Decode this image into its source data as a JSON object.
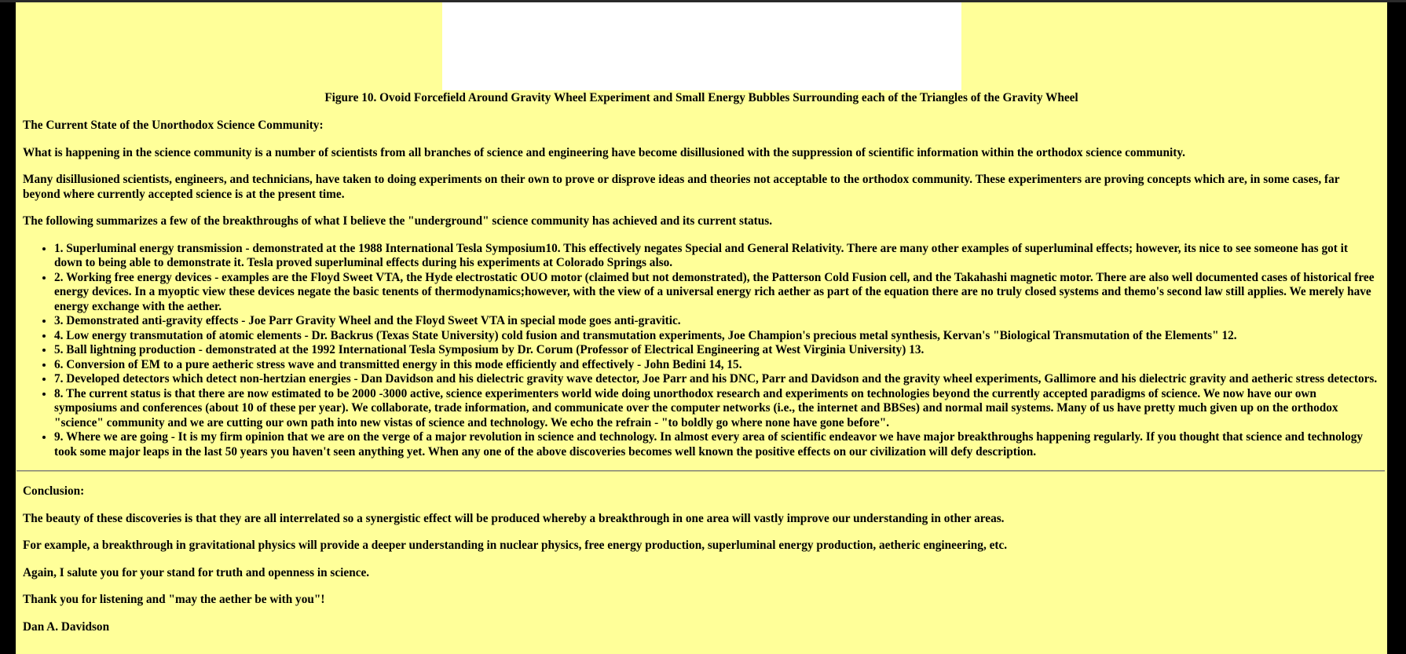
{
  "figure": {
    "caption": "Figure 10. Ovoid Forcefield Around Gravity Wheel Experiment and Small Energy Bubbles Surrounding each of the Triangles of the Gravity Wheel"
  },
  "section": {
    "heading": "The Current State of the Unorthodox Science Community:",
    "paragraphs": [
      "What is happening in the science community is a number of scientists from all branches of science and engineering have become disillusioned with the suppression of scientific information within the orthodox science community.",
      "Many disillusioned scientists, engineers, and technicians, have taken to doing experiments on their own to prove or disprove ideas and theories not acceptable to the orthodox community. These experimenters are proving concepts which are, in some cases, far beyond where currently accepted science is at the present time.",
      "The following summarizes a few of the breakthroughs of what I believe the \"underground\" science community has achieved and its current status."
    ],
    "list": [
      "1. Superluminal energy transmission - demonstrated at the 1988 International Tesla Symposium10. This effectively negates Special and General Relativity. There are many other examples of superluminal effects; however, its nice to see someone has got it down to being able to demonstrate it. Tesla proved superluminal effects during his experiments at Colorado Springs also.",
      "2. Working free energy devices - examples are the Floyd Sweet VTA, the Hyde electrostatic OUO motor (claimed but not demonstrated), the Patterson Cold Fusion cell, and the Takahashi magnetic motor. There are also well documented cases of historical free energy devices. In a myoptic view these devices negate the basic tenents of thermodynamics;however, with the view of a universal energy rich aether as part of the equation there are no truly closed systems and themo's second law still applies. We merely have energy exchange with the aether.",
      "3. Demonstrated anti-gravity effects - Joe Parr Gravity Wheel and the Floyd Sweet VTA in special mode goes anti-gravitic.",
      "4. Low energy transmutation of atomic elements - Dr. Backrus (Texas State University) cold fusion and transmutation experiments, Joe Champion's precious metal synthesis, Kervan's \"Biological Transmutation of the Elements\" 12.",
      "5. Ball lightning production - demonstrated at the 1992 International Tesla Symposium by Dr. Corum (Professor of Electrical Engineering at West Virginia University) 13.",
      "6. Conversion of EM to a pure aetheric stress wave and transmitted energy in this mode efficiently and effectively - John Bedini 14, 15.",
      "7. Developed detectors which detect non-hertzian energies - Dan Davidson and his dielectric gravity wave detector, Joe Parr and his DNC, Parr and Davidson and the gravity wheel experiments, Gallimore and his dielectric gravity and aetheric stress detectors.",
      "8. The current status is that there are now estimated to be 2000 -3000 active, science experimenters world wide doing unorthodox research and experiments on technologies beyond the currently accepted paradigms of science. We now have our own symposiums and conferences (about 10 of these per year). We collaborate, trade information, and communicate over the computer networks (i.e., the internet and BBSes) and normal mail systems. Many of us have pretty much given up on the orthodox \"science\" community and we are cutting our own path into new vistas of science and technology. We echo the refrain - \"to boldly go where none have gone before\".",
      "9. Where we are going - It is my firm opinion that we are on the verge of a major revolution in science and technology. In almost every area of scientific endeavor we have major breakthroughs happening regularly. If you thought that science and technology took some major leaps in the last 50 years you haven't seen anything yet. When any one of the above discoveries becomes well known the positive effects on our civilization will defy description."
    ]
  },
  "conclusion": {
    "heading": "Conclusion:",
    "paragraphs": [
      "The beauty of these discoveries is that they are all interrelated so a synergistic effect will be produced whereby a breakthrough in one area will vastly improve our understanding in other areas.",
      "For example, a breakthrough in gravitational physics will provide a deeper understanding in nuclear physics, free energy production, superluminal energy production, aetheric engineering, etc.",
      "Again, I salute you for your stand for truth and openness in science.",
      "Thank you for listening and \"may the aether be with you\"!"
    ],
    "signature": "Dan A. Davidson"
  },
  "colors": {
    "page_background": "#ffff99",
    "figure_background": "#ffffff",
    "outer_background": "#000000"
  }
}
